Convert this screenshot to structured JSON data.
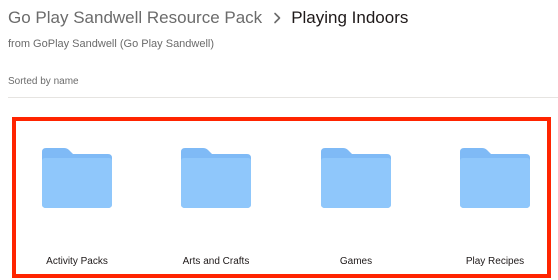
{
  "breadcrumb": {
    "parent": "Go Play Sandwell Resource Pack",
    "separator_icon": "chevron-right-icon",
    "current": "Playing Indoors"
  },
  "owner_text": "from GoPlay Sandwell (Go Play Sandwell)",
  "sort": {
    "label": "Sorted by name"
  },
  "folders": [
    {
      "name": "Activity Packs",
      "icon": "folder-icon"
    },
    {
      "name": "Arts and Crafts",
      "icon": "folder-icon"
    },
    {
      "name": "Games",
      "icon": "folder-icon"
    },
    {
      "name": "Play Recipes",
      "icon": "folder-icon"
    }
  ],
  "colors": {
    "folder_fill": "#8fc7fb",
    "folder_back": "#7fbaf6",
    "highlight_border": "#ff2400",
    "muted_text": "#6b6b6b"
  }
}
